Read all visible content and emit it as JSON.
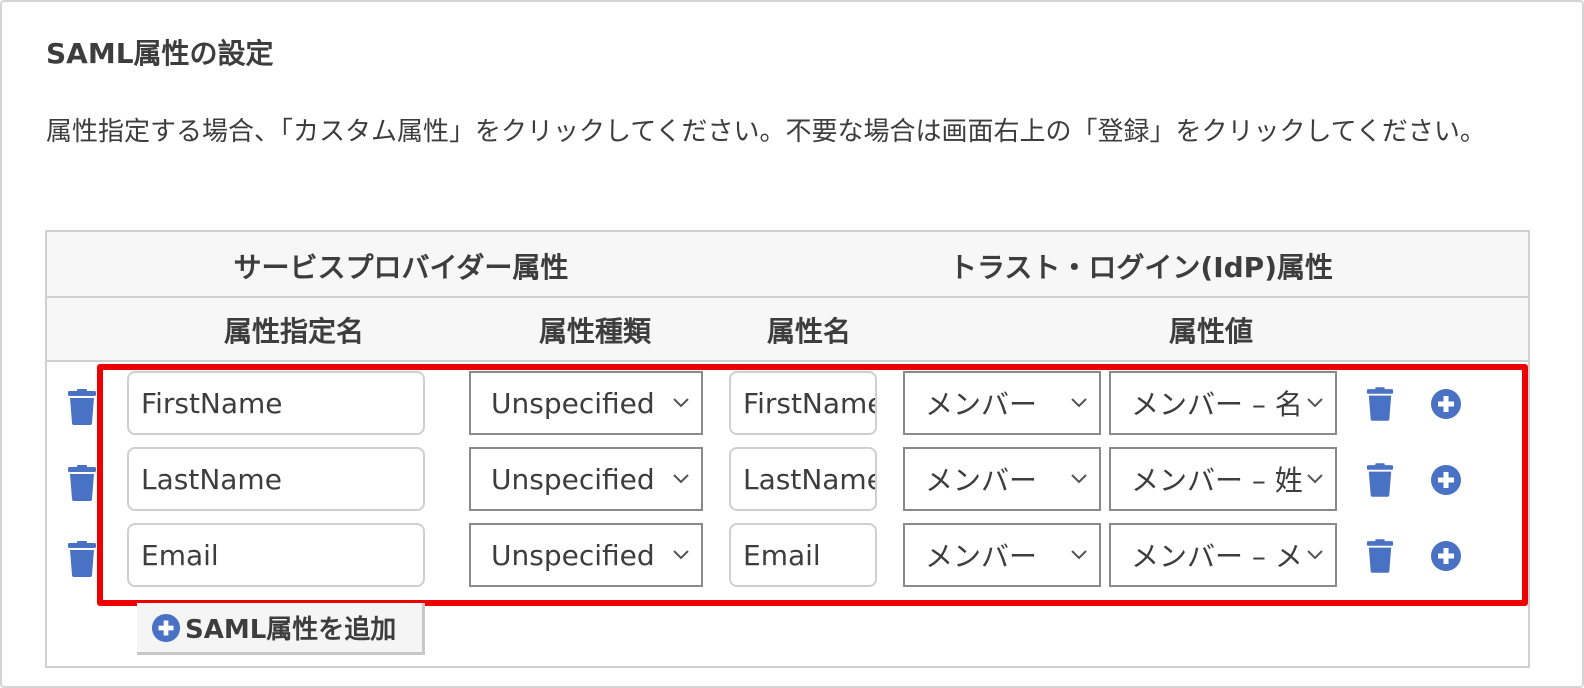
{
  "section": {
    "title": "SAML属性の設定",
    "description": "属性指定する場合、「カスタム属性」をクリックしてください。不要な場合は画面右上の「登録」をクリックしてください。"
  },
  "table": {
    "group_headers": {
      "sp": "サービスプロバイダー属性",
      "idp": "トラスト・ログイン(IdP)属性"
    },
    "column_headers": {
      "attr_spec_name": "属性指定名",
      "attr_type": "属性種類",
      "attr_name": "属性名",
      "attr_value": "属性値"
    },
    "rows": [
      {
        "spec_name": "FirstName",
        "type": "Unspecified",
        "name": "FirstName",
        "value_category": "メンバー",
        "value_field": "メンバー – 名"
      },
      {
        "spec_name": "LastName",
        "type": "Unspecified",
        "name": "LastName",
        "value_category": "メンバー",
        "value_field": "メンバー – 姓"
      },
      {
        "spec_name": "Email",
        "type": "Unspecified",
        "name": "Email",
        "value_category": "メンバー",
        "value_field": "メンバー – メールアドレス"
      }
    ]
  },
  "add_button": {
    "label": "SAML属性を追加"
  },
  "colors": {
    "accent_icon": "#4a72c4",
    "highlight": "#ee0000",
    "header_bg": "#f7f7f7"
  },
  "icons": {
    "delete": "trash-icon",
    "add": "plus-circle-icon",
    "dropdown": "chevron-down-icon"
  }
}
